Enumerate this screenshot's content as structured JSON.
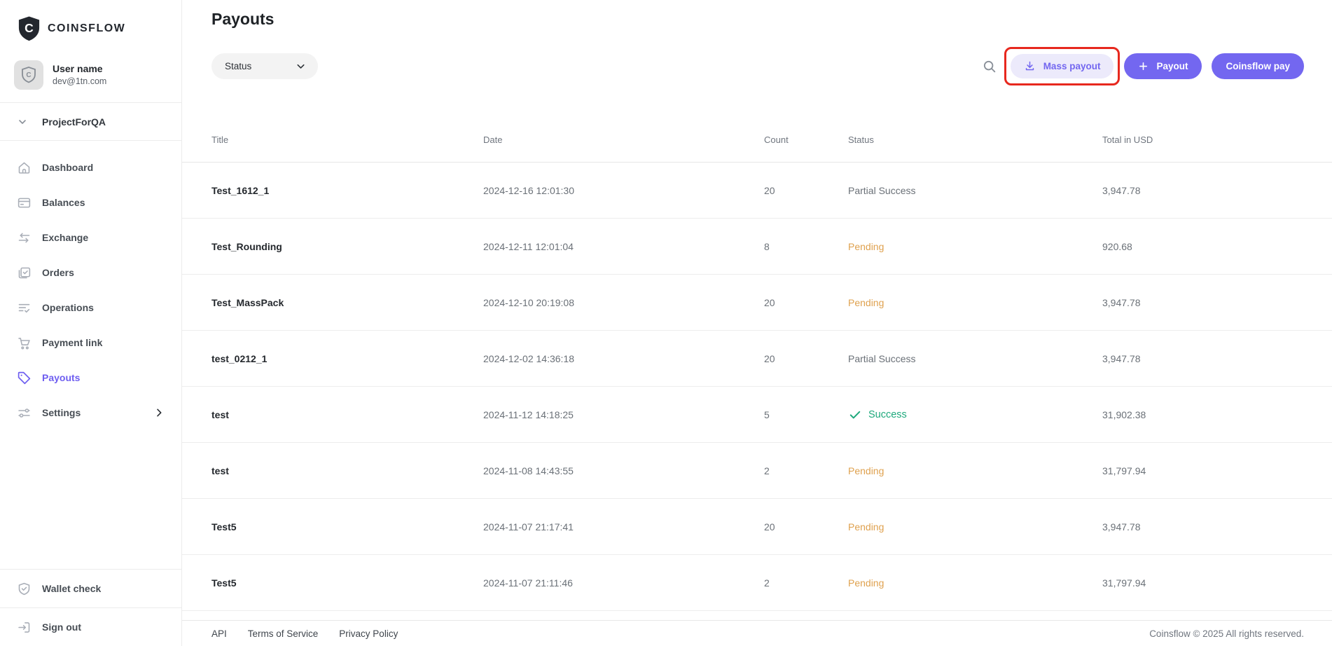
{
  "brand": {
    "name": "COINSFLOW"
  },
  "user": {
    "name": "User name",
    "email": "dev@1tn.com"
  },
  "project": {
    "name": "ProjectForQA"
  },
  "sidebar": {
    "items": [
      {
        "label": "Dashboard",
        "icon": "home-icon",
        "active": false
      },
      {
        "label": "Balances",
        "icon": "card-icon",
        "active": false
      },
      {
        "label": "Exchange",
        "icon": "exchange-icon",
        "active": false
      },
      {
        "label": "Orders",
        "icon": "orders-icon",
        "active": false
      },
      {
        "label": "Operations",
        "icon": "operations-icon",
        "active": false
      },
      {
        "label": "Payment link",
        "icon": "cart-icon",
        "active": false
      },
      {
        "label": "Payouts",
        "icon": "tag-icon",
        "active": true
      },
      {
        "label": "Settings",
        "icon": "sliders-icon",
        "active": false,
        "has_chevron": true
      }
    ],
    "footer_items": [
      {
        "label": "Wallet check",
        "icon": "shield-check-icon"
      },
      {
        "label": "Sign out",
        "icon": "logout-icon"
      }
    ]
  },
  "header": {
    "title": "Payouts",
    "status_filter_label": "Status",
    "buttons": {
      "mass_payout": "Mass payout",
      "payout": "Payout",
      "coinsflow_pay": "Coinsflow pay"
    },
    "annotation": {
      "shape": "red-rounded-rectangle",
      "target": "mass-payout-button"
    }
  },
  "table": {
    "columns": [
      "Title",
      "Date",
      "Count",
      "Status",
      "Total in USD"
    ],
    "rows": [
      {
        "title": "Test_1612_1",
        "date": "2024-12-16 12:01:30",
        "count": "20",
        "status": "Partial Success",
        "status_type": "partial",
        "total": "3,947.78"
      },
      {
        "title": "Test_Rounding",
        "date": "2024-12-11 12:01:04",
        "count": "8",
        "status": "Pending",
        "status_type": "pending",
        "total": "920.68"
      },
      {
        "title": "Test_MassPack",
        "date": "2024-12-10 20:19:08",
        "count": "20",
        "status": "Pending",
        "status_type": "pending",
        "total": "3,947.78"
      },
      {
        "title": "test_0212_1",
        "date": "2024-12-02 14:36:18",
        "count": "20",
        "status": "Partial Success",
        "status_type": "partial",
        "total": "3,947.78"
      },
      {
        "title": "test",
        "date": "2024-11-12 14:18:25",
        "count": "5",
        "status": "Success",
        "status_type": "success",
        "total": "31,902.38"
      },
      {
        "title": "test",
        "date": "2024-11-08 14:43:55",
        "count": "2",
        "status": "Pending",
        "status_type": "pending",
        "total": "31,797.94"
      },
      {
        "title": "Test5",
        "date": "2024-11-07 21:17:41",
        "count": "20",
        "status": "Pending",
        "status_type": "pending",
        "total": "3,947.78"
      },
      {
        "title": "Test5",
        "date": "2024-11-07 21:11:46",
        "count": "2",
        "status": "Pending",
        "status_type": "pending",
        "total": "31,797.94"
      }
    ]
  },
  "footer": {
    "links": [
      "API",
      "Terms of Service",
      "Privacy Policy"
    ],
    "copyright": "Coinsflow © 2025 All rights reserved."
  },
  "colors": {
    "accent": "#7367F0",
    "accent_light": "#ECEAFB",
    "pending": "#DFA14E",
    "success": "#1EA97C",
    "muted_text": "#6A7077",
    "annotation_red": "#E7281E"
  }
}
